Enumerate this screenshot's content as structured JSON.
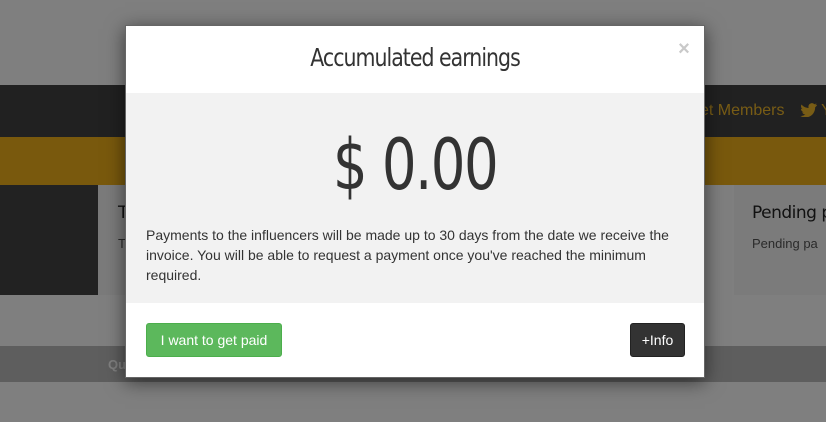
{
  "background": {
    "nav": {
      "members_link": "et Members",
      "twitter_partial": "Y",
      "twitter_icon": "twitter-icon"
    },
    "card_left": {
      "title": "T",
      "text": "T"
    },
    "card_right": {
      "title": "Pending pa",
      "text": "Pending pa"
    },
    "bar_label": "Qu"
  },
  "modal": {
    "title": "Accumulated earnings",
    "close_label": "×",
    "amount": "$ 0.00",
    "description": "Payments to the influencers will be made up to 30 days from the date we receive the invoice. You will be able to request a payment once you've reached the minimum required.",
    "paid_button": "I want to get paid",
    "info_button": "+Info"
  },
  "colors": {
    "nav_link": "#f0b82a",
    "yellow_band": "#f2b21a",
    "paid_button": "#5cb85c",
    "info_button": "#333333"
  }
}
